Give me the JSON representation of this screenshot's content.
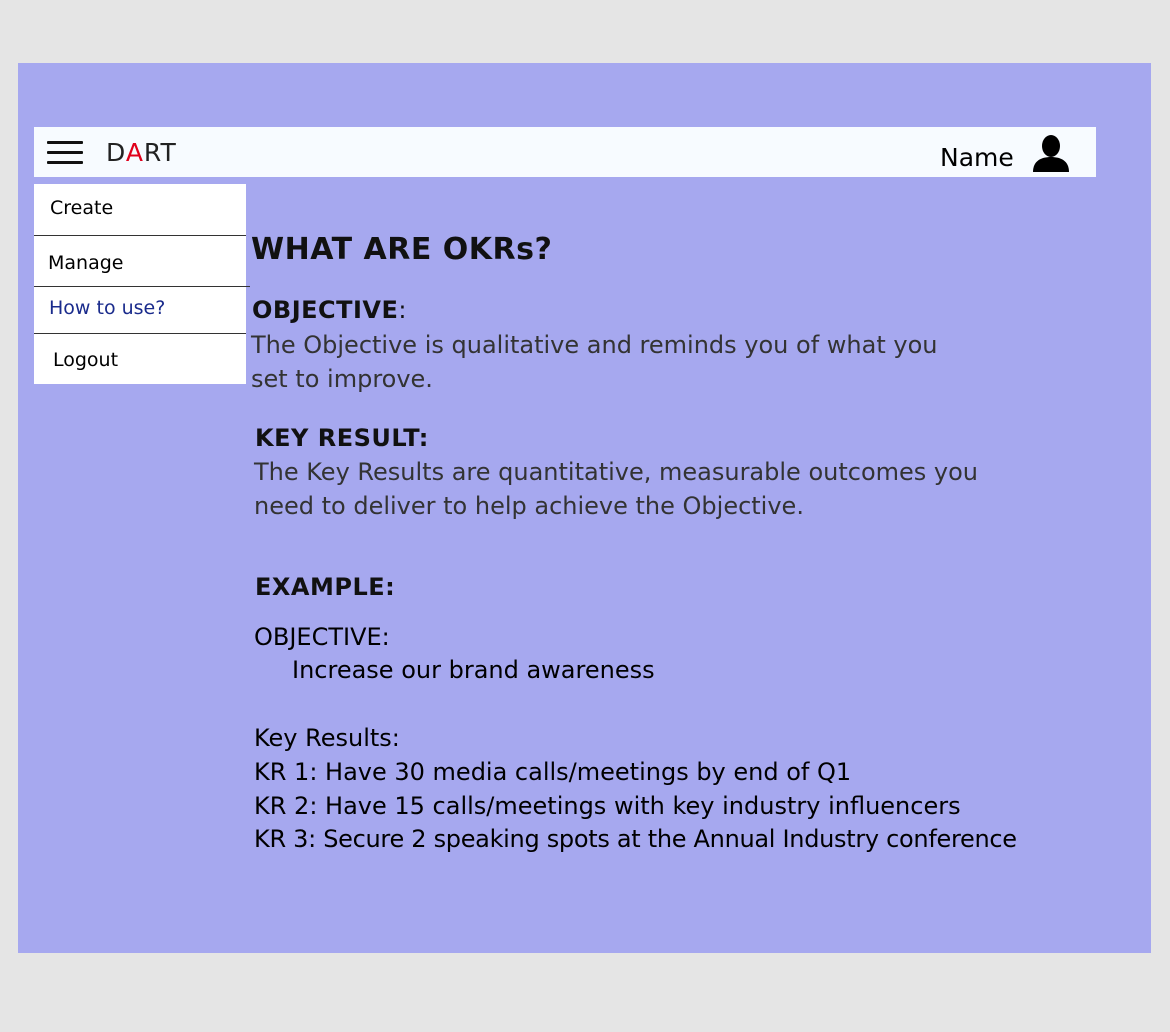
{
  "header": {
    "brand_prefix": "D",
    "brand_accent": "A",
    "brand_suffix": "RT",
    "user_name": "Name",
    "menu_icon": "hamburger-icon",
    "avatar_icon": "user-icon"
  },
  "menu": {
    "items": [
      {
        "label": "Create"
      },
      {
        "label": "Manage"
      },
      {
        "label": "How to use?"
      },
      {
        "label": "Logout"
      }
    ]
  },
  "content": {
    "title": "WHAT ARE OKRs?",
    "objective_heading": "OBJECTIVE",
    "objective_colon": ":",
    "objective_text_1": "The Objective is qualitative and reminds you of what you",
    "objective_text_2": "set to improve.",
    "key_result_heading": "KEY RESULT:",
    "key_result_text_1": "The Key Results are quantitative, measurable outcomes you",
    "key_result_text_2": "need to deliver to help achieve the Objective.",
    "example_heading": "EXAMPLE:",
    "example_objective_label": "OBJECTIVE:",
    "example_objective_value": "Increase our brand awareness",
    "example_key_results_label": "Key Results:",
    "example_key_results": [
      "KR 1: Have 30 media calls/meetings by end of Q1",
      "KR 2: Have 15 calls/meetings with key industry influencers",
      "KR 3: Secure 2 speaking spots at the Annual Industry conference"
    ]
  },
  "colors": {
    "background": "#e5e5e5",
    "frame": "#a6a8ef",
    "topbar": "#f7fbff",
    "brand_accent": "#e0001b",
    "menu_active": "#1a2b8c"
  }
}
